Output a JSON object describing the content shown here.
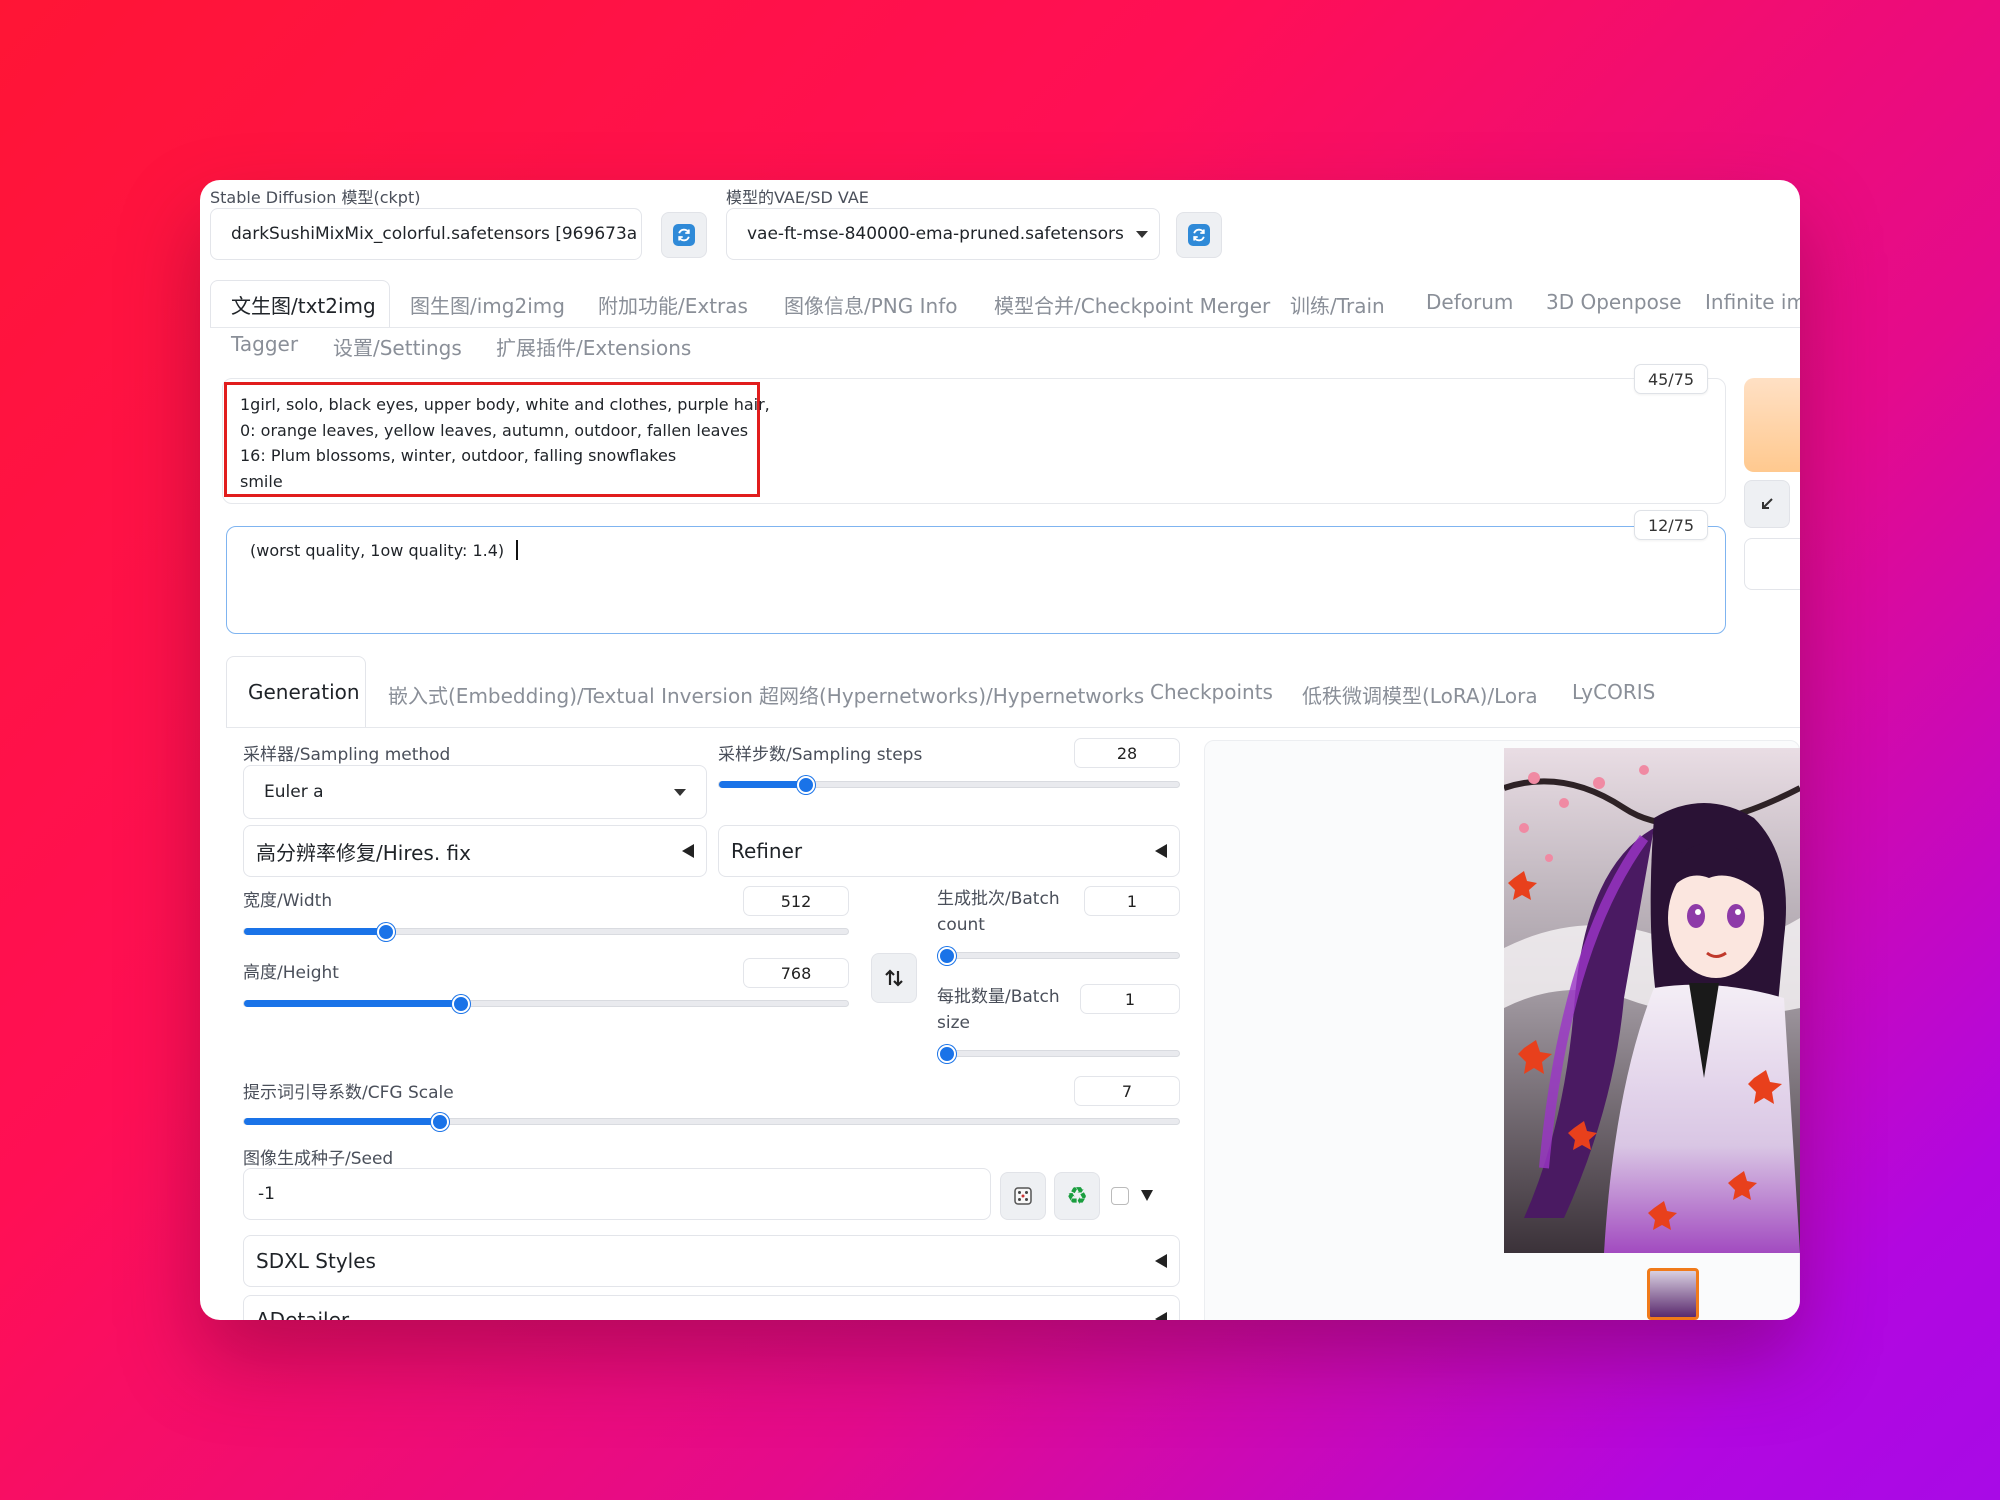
{
  "model": {
    "label": "Stable Diffusion 模型(ckpt)",
    "value": "darkSushiMixMix_colorful.safetensors [969673a"
  },
  "vae": {
    "label": "模型的VAE/SD VAE",
    "value": "vae-ft-mse-840000-ema-pruned.safetensors"
  },
  "main_tabs": [
    "文生图/txt2img",
    "图生图/img2img",
    "附加功能/Extras",
    "图像信息/PNG Info",
    "模型合并/Checkpoint Merger",
    "训练/Train",
    "Deforum",
    "3D Openpose",
    "Infinite ima",
    "Tagger",
    "设置/Settings",
    "扩展插件/Extensions"
  ],
  "prompt": {
    "lines": [
      "1girl, solo, black eyes, upper body, white and clothes, purple hair,",
      "0: orange leaves, yellow leaves, autumn, outdoor, fallen leaves",
      "16: Plum blossoms, winter, outdoor, falling snowflakes",
      "smile"
    ],
    "counter": "45/75"
  },
  "negative_prompt": {
    "text": "(worst quality, 1ow quality: 1.4)",
    "counter": "12/75"
  },
  "sub_tabs": [
    "Generation",
    "嵌入式(Embedding)/Textual Inversion",
    "超网络(Hypernetworks)/Hypernetworks",
    "Checkpoints",
    "低秩微调模型(LoRA)/Lora",
    "LyCORIS"
  ],
  "sampler": {
    "label": "采样器/Sampling method",
    "value": "Euler a"
  },
  "steps": {
    "label": "采样步数/Sampling steps",
    "value": "28",
    "fraction": 0.19
  },
  "hires": {
    "label": "高分辨率修复/Hires. fix"
  },
  "refiner": {
    "label": "Refiner"
  },
  "width": {
    "label": "宽度/Width",
    "value": "512",
    "fraction": 0.235
  },
  "height": {
    "label": "高度/Height",
    "value": "768",
    "fraction": 0.36
  },
  "batch_count": {
    "label1": "生成批次/Batch",
    "label2": "count",
    "value": "1",
    "fraction": 0.0
  },
  "batch_size": {
    "label1": "每批数量/Batch",
    "label2": "size",
    "value": "1",
    "fraction": 0.0
  },
  "cfg": {
    "label": "提示词引导系数/CFG Scale",
    "value": "7",
    "fraction": 0.21
  },
  "seed": {
    "label": "图像生成种子/Seed",
    "value": "-1"
  },
  "sdxl_styles": {
    "label": "SDXL Styles"
  },
  "adetailer": {
    "label": "ADetailer"
  },
  "icons": {
    "refresh": "refresh-icon",
    "dice": "dice-icon",
    "recycle": "recycle-icon",
    "swap": "swap-arrows-icon",
    "collapse": "collapse-arrow-icon"
  },
  "colors": {
    "accent": "#1a73e8",
    "highlight": "#e11d1d",
    "generate": "#ffc98f"
  }
}
